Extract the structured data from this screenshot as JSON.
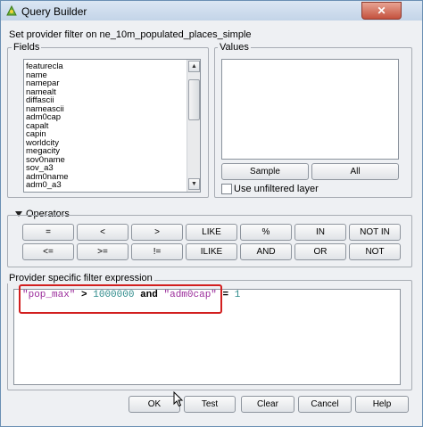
{
  "window": {
    "title": "Query Builder",
    "close_label": "✕"
  },
  "header_text": "Set provider filter on ne_10m_populated_places_simple",
  "fields": {
    "title": "Fields",
    "items": [
      "featurecla",
      "name",
      "namepar",
      "namealt",
      "diffascii",
      "nameascii",
      "adm0cap",
      "capalt",
      "capin",
      "worldcity",
      "megacity",
      "sov0name",
      "sov_a3",
      "adm0name",
      "adm0_a3"
    ]
  },
  "values": {
    "title": "Values",
    "sample_label": "Sample",
    "all_label": "All",
    "unfiltered_label": "Use unfiltered layer"
  },
  "operators": {
    "title": "Operators",
    "row1": [
      "=",
      "<",
      ">",
      "LIKE",
      "%",
      "IN",
      "NOT IN"
    ],
    "row2": [
      "<=",
      ">=",
      "!=",
      "ILIKE",
      "AND",
      "OR",
      "NOT"
    ]
  },
  "expression": {
    "title": "Provider specific filter expression",
    "field1": "\"pop_max\"",
    "op1": ">",
    "val1": "1000000",
    "conj": "and",
    "field2": "\"adm0cap\"",
    "op2": "=",
    "val2": "1"
  },
  "buttons": {
    "ok": "OK",
    "test": "Test",
    "clear": "Clear",
    "cancel": "Cancel",
    "help": "Help"
  }
}
